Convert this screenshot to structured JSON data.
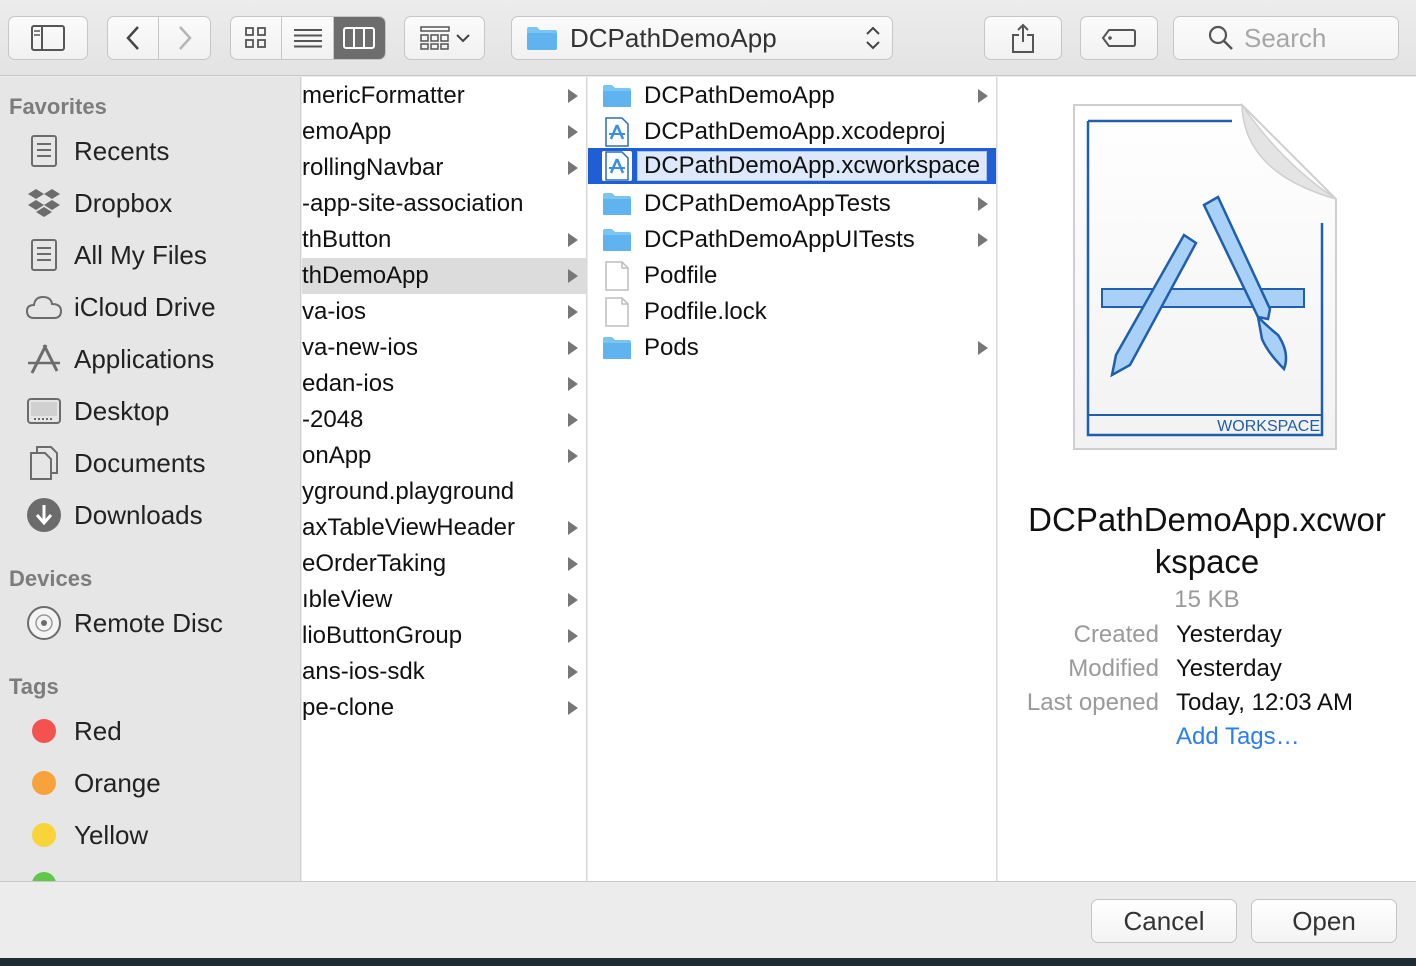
{
  "toolbar": {
    "path_label": "DCPathDemoApp",
    "search_placeholder": "Search"
  },
  "sidebar": {
    "favorites_header": "Favorites",
    "favorites": [
      {
        "label": "Recents",
        "icon": "recents-icon"
      },
      {
        "label": "Dropbox",
        "icon": "dropbox-icon"
      },
      {
        "label": "All My Files",
        "icon": "all-my-files-icon"
      },
      {
        "label": "iCloud Drive",
        "icon": "icloud-icon"
      },
      {
        "label": "Applications",
        "icon": "applications-icon"
      },
      {
        "label": "Desktop",
        "icon": "desktop-icon"
      },
      {
        "label": "Documents",
        "icon": "documents-icon"
      },
      {
        "label": "Downloads",
        "icon": "downloads-icon"
      }
    ],
    "devices_header": "Devices",
    "devices": [
      {
        "label": "Remote Disc",
        "icon": "remote-disc-icon"
      }
    ],
    "tags_header": "Tags",
    "tags": [
      {
        "label": "Red",
        "color": "#f4524f"
      },
      {
        "label": "Orange",
        "color": "#f7a23b"
      },
      {
        "label": "Yellow",
        "color": "#f8d33a"
      }
    ]
  },
  "column1": {
    "items": [
      {
        "name": "mericFormatter",
        "arrow": true
      },
      {
        "name": "emoApp",
        "arrow": true
      },
      {
        "name": "rollingNavbar",
        "arrow": true
      },
      {
        "name": "-app-site-association",
        "arrow": false
      },
      {
        "name": "thButton",
        "arrow": true
      },
      {
        "name": "thDemoApp",
        "arrow": true,
        "selected": true
      },
      {
        "name": "va-ios",
        "arrow": true
      },
      {
        "name": "va-new-ios",
        "arrow": true
      },
      {
        "name": "edan-ios",
        "arrow": true
      },
      {
        "name": "-2048",
        "arrow": true
      },
      {
        "name": "onApp",
        "arrow": true
      },
      {
        "name": "yground.playground",
        "arrow": false
      },
      {
        "name": "axTableViewHeader",
        "arrow": true
      },
      {
        "name": "eOrderTaking",
        "arrow": true
      },
      {
        "name": "ıbleView",
        "arrow": true
      },
      {
        "name": "lioButtonGroup",
        "arrow": true
      },
      {
        "name": "ans-ios-sdk",
        "arrow": true
      },
      {
        "name": "pe-clone",
        "arrow": true
      }
    ]
  },
  "column2": {
    "items": [
      {
        "name": "DCPathDemoApp",
        "type": "folder",
        "arrow": true
      },
      {
        "name": "DCPathDemoApp.xcodeproj",
        "type": "xcode",
        "arrow": false
      },
      {
        "name": "DCPathDemoApp.xcworkspace",
        "type": "xcode",
        "arrow": false,
        "selected": true
      },
      {
        "name": "DCPathDemoAppTests",
        "type": "folder",
        "arrow": true
      },
      {
        "name": "DCPathDemoAppUITests",
        "type": "folder",
        "arrow": true
      },
      {
        "name": "Podfile",
        "type": "doc",
        "arrow": false
      },
      {
        "name": "Podfile.lock",
        "type": "doc",
        "arrow": false
      },
      {
        "name": "Pods",
        "type": "folder",
        "arrow": true
      }
    ]
  },
  "preview": {
    "icon_label": "WORKSPACE",
    "name_line1": "DCPathDemoApp.xcwor",
    "name_line2": "kspace",
    "size": "15 KB",
    "created_label": "Created",
    "created_value": "Yesterday",
    "modified_label": "Modified",
    "modified_value": "Yesterday",
    "last_opened_label": "Last opened",
    "last_opened_value": "Today, 12:03 AM",
    "add_tags": "Add Tags…"
  },
  "buttons": {
    "cancel": "Cancel",
    "open": "Open"
  }
}
